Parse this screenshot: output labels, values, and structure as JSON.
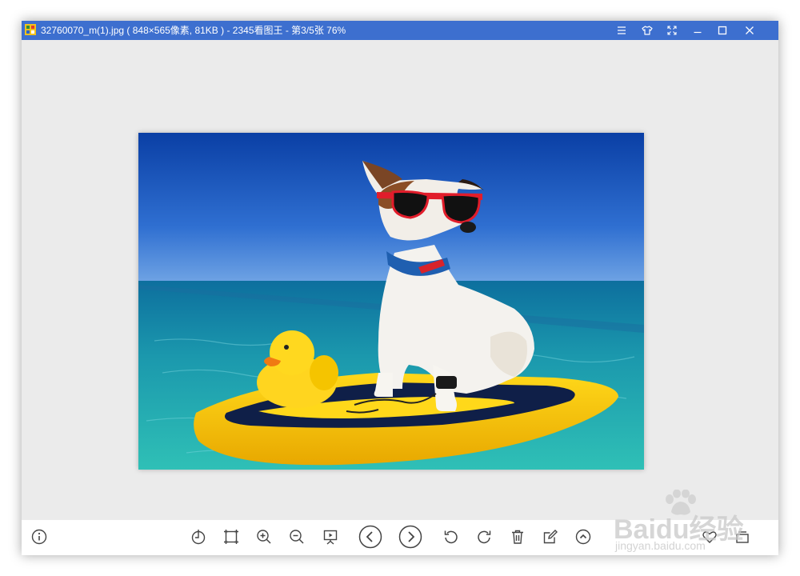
{
  "window": {
    "title": "32760070_m(1).jpg ( 848×565像素, 81KB ) - 2345看图王 - 第3/5张 76%",
    "accent_color": "#3d6fcf",
    "controls": [
      {
        "name": "menu",
        "icon": "hamburger-menu-icon"
      },
      {
        "name": "skin",
        "icon": "shirt-icon"
      },
      {
        "name": "fullscreen",
        "icon": "fullscreen-icon"
      },
      {
        "name": "minimize",
        "icon": "minimize-icon"
      },
      {
        "name": "maximize",
        "icon": "maximize-icon"
      },
      {
        "name": "close",
        "icon": "close-icon"
      }
    ]
  },
  "image": {
    "file_name": "32760070_m(1).jpg",
    "dimensions": "848×565像素",
    "size": "81KB",
    "position": "第3/5张",
    "zoom": "76%",
    "content": "dog-with-sunglasses-on-surfboard-with-rubber-duck"
  },
  "toolbar": {
    "left": [
      {
        "name": "info",
        "icon": "info-icon"
      }
    ],
    "center": [
      {
        "name": "actual-size",
        "icon": "original-size-icon"
      },
      {
        "name": "fit-window",
        "icon": "fit-window-icon"
      },
      {
        "name": "zoom-in",
        "icon": "zoom-in-icon"
      },
      {
        "name": "zoom-out",
        "icon": "zoom-out-icon"
      },
      {
        "name": "slideshow",
        "icon": "slideshow-icon"
      },
      {
        "name": "previous",
        "icon": "previous-icon"
      },
      {
        "name": "next",
        "icon": "next-icon"
      },
      {
        "name": "rotate-left",
        "icon": "rotate-left-icon"
      },
      {
        "name": "rotate-right",
        "icon": "rotate-right-icon"
      },
      {
        "name": "delete",
        "icon": "trash-icon"
      },
      {
        "name": "edit",
        "icon": "edit-icon"
      },
      {
        "name": "more",
        "icon": "more-up-icon"
      }
    ],
    "right": [
      {
        "name": "favorite",
        "icon": "heart-icon"
      },
      {
        "name": "thumbnails",
        "icon": "thumbnail-icon"
      }
    ]
  },
  "watermark": {
    "brand": "Bai",
    "brand2": "du",
    "brand3": "经验",
    "url": "jingyan.baidu.com"
  }
}
